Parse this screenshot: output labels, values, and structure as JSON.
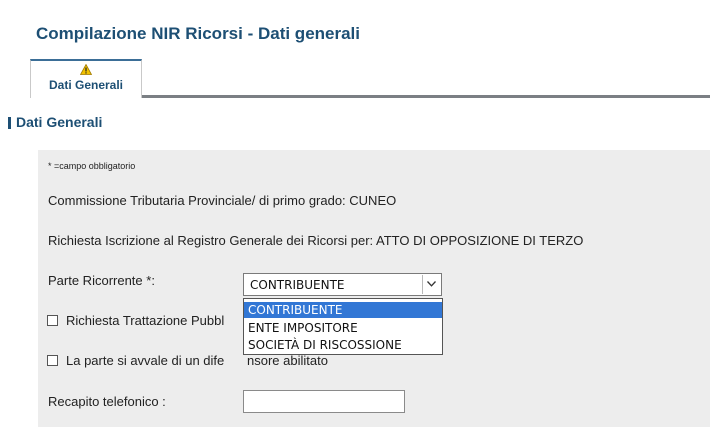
{
  "page": {
    "title": "Compilazione NIR Ricorsi - Dati generali"
  },
  "tabs": [
    {
      "label": "Dati Generali",
      "icon": "warning-icon"
    }
  ],
  "section": {
    "title": "Dati Generali"
  },
  "form": {
    "required_note": "* =campo obbligatorio",
    "commissione": "Commissione Tributaria Provinciale/ di primo grado: CUNEO",
    "richiesta_iscrizione": "Richiesta Iscrizione al Registro Generale dei Ricorsi per: ATTO DI OPPOSIZIONE DI TERZO",
    "parte_ricorrente": {
      "label": "Parte Ricorrente *:",
      "value": "CONTRIBUENTE",
      "options": [
        "CONTRIBUENTE",
        "ENTE IMPOSITORE",
        "SOCIETÀ DI RISCOSSIONE"
      ]
    },
    "trattazione_label": "Richiesta Trattazione Pubbl",
    "difensore_label_a": "La parte si avvale di un dife",
    "difensore_label_b": "nsore abilitato",
    "recapito_label": "Recapito telefonico  :",
    "recapito_value": ""
  },
  "colors": {
    "accent": "#1d4f74",
    "selected": "#3277d5",
    "panel": "#ededed"
  }
}
